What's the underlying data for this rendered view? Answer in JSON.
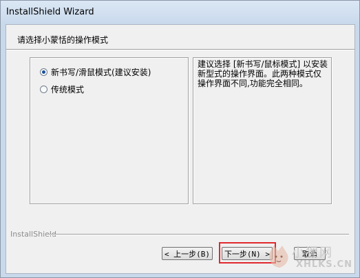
{
  "window": {
    "title": "InstallShield Wizard"
  },
  "header": {
    "instruction": "请选择小蒙恬的操作模式"
  },
  "options": [
    {
      "label": "新书写/滑鼠模式(建议安装)",
      "selected": true
    },
    {
      "label": "传统模式",
      "selected": false
    }
  ],
  "description": "建议选择 [新书写/鼠标模式] 以安装新型式的操作界面。此两种模式仅操作界面不同,功能完全相同。",
  "footer": {
    "brand": "InstallShield",
    "back_label": "< 上一步(B)",
    "next_label": "下一步(N) >",
    "cancel_label": "取消"
  },
  "watermark": {
    "site_name": "小狸网",
    "domain": "XHLKS.CN"
  },
  "colors": {
    "highlight": "#e0282e",
    "title_bar": "#c9d9ec",
    "dialog_bg": "#f0f0f0"
  }
}
